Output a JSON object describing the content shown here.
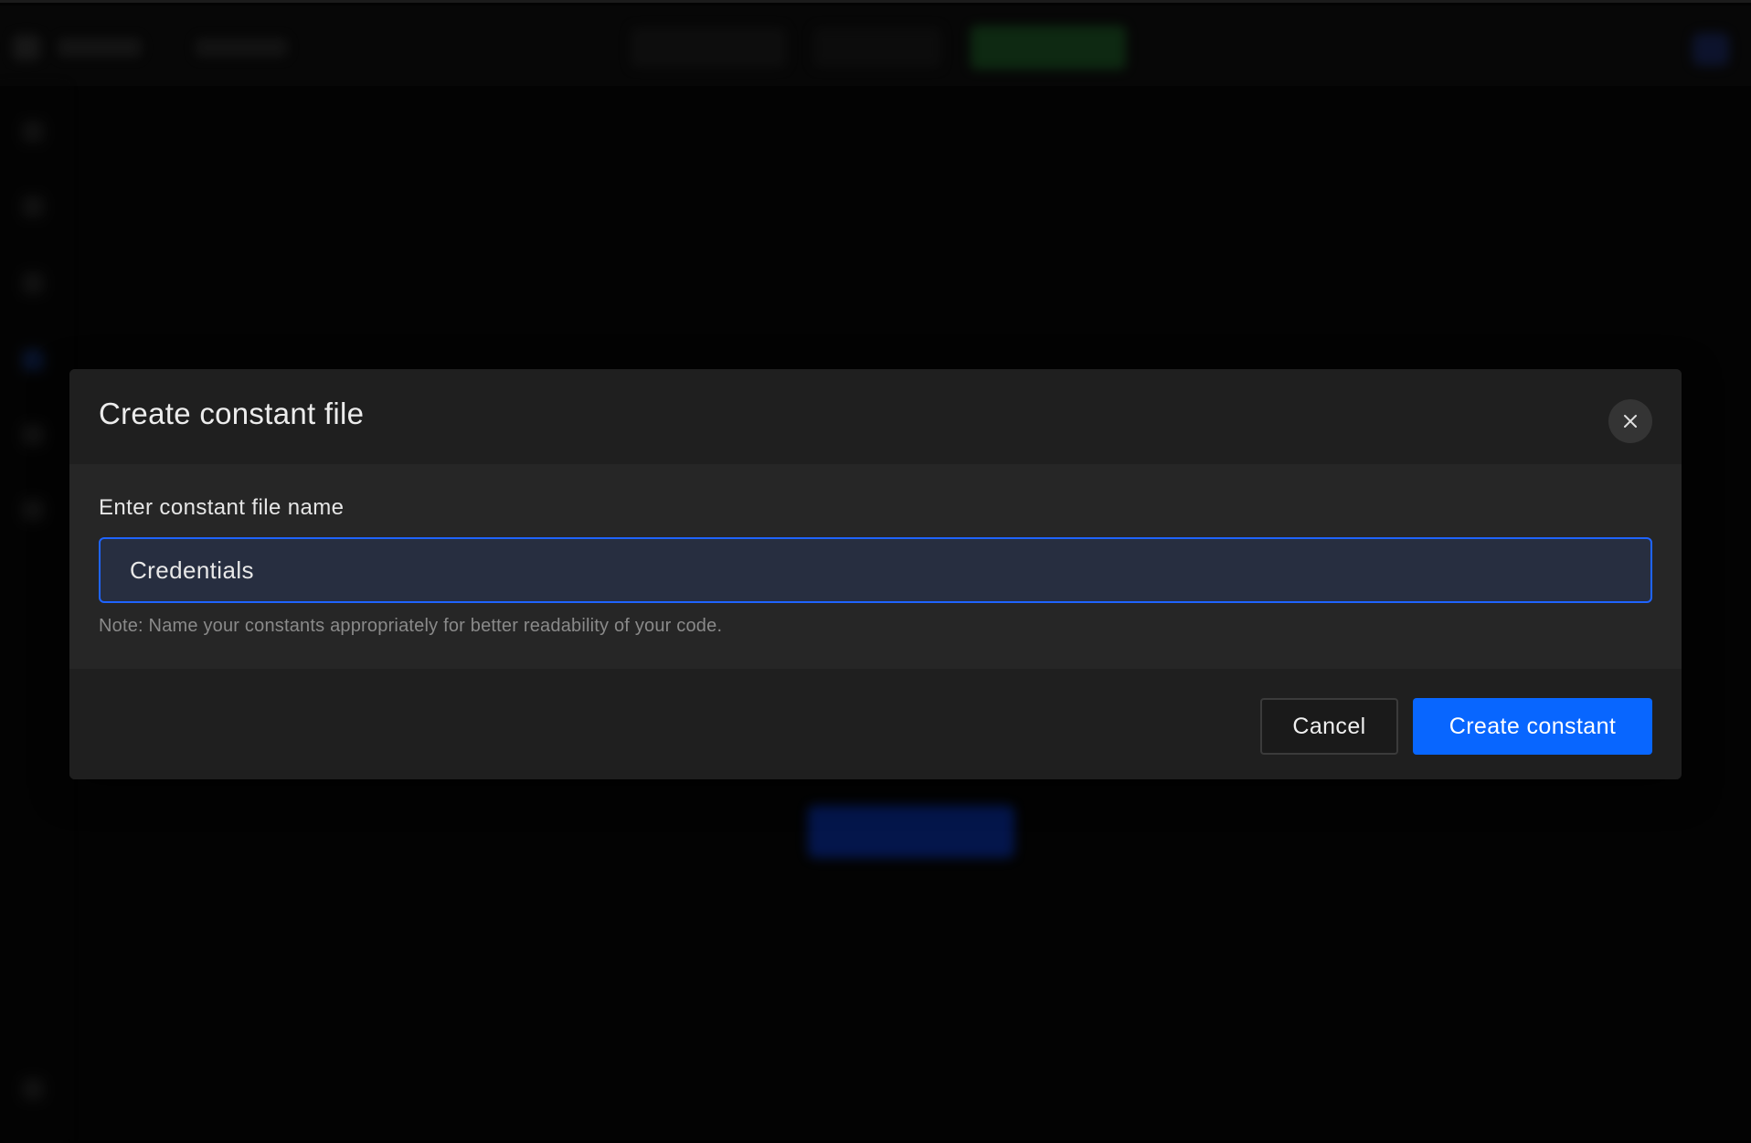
{
  "modal": {
    "title": "Create constant file",
    "field_label": "Enter constant file name",
    "input_value": "Credentials",
    "note": "Note: Name your constants appropriately for better readability of your code.",
    "cancel_label": "Cancel",
    "submit_label": "Create constant",
    "close_icon": "close-icon"
  },
  "colors": {
    "accent": "#0866ff",
    "input_border": "#1f64ff",
    "input_bg": "#272e40",
    "modal_bg": "#202020",
    "backdrop": "#000000"
  }
}
